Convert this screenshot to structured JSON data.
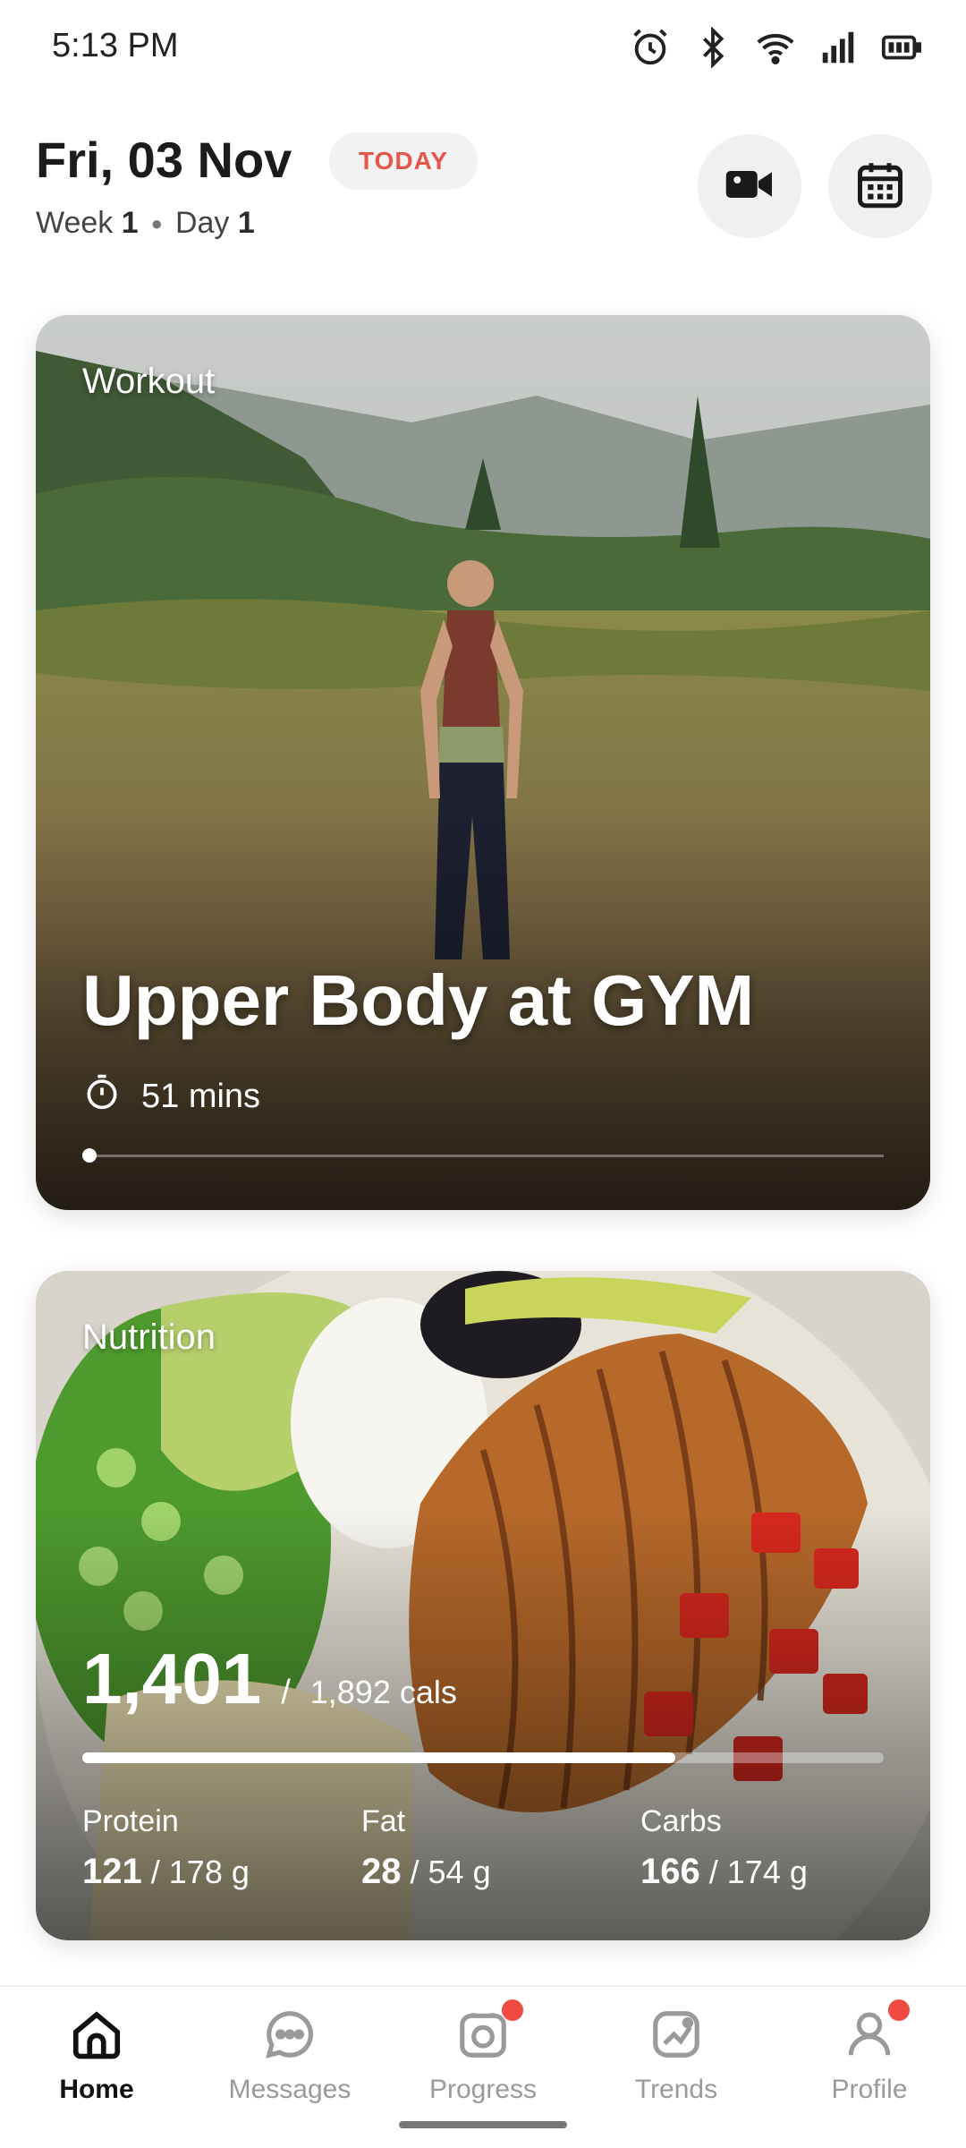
{
  "status_bar": {
    "time": "5:13 PM",
    "icons": [
      "alarm-icon",
      "bluetooth-icon",
      "wifi-icon",
      "signal-icon",
      "battery-icon"
    ]
  },
  "header": {
    "date": "Fri, 03 Nov",
    "today_badge": "TODAY",
    "week_label": "Week",
    "week_value": "1",
    "day_label": "Day",
    "day_value": "1",
    "buttons": [
      "video-camera-icon",
      "calendar-icon"
    ]
  },
  "workout": {
    "label": "Workout",
    "title": "Upper Body at GYM",
    "duration": "51 mins",
    "progress": 0
  },
  "nutrition": {
    "label": "Nutrition",
    "calories_eaten": "1,401",
    "separator": "/",
    "calories_goal": "1,892 cals",
    "progress": 0.7405,
    "macros": {
      "protein": {
        "label": "Protein",
        "value": "121",
        "goal": "/ 178 g"
      },
      "fat": {
        "label": "Fat",
        "value": "28",
        "goal": "/ 54 g"
      },
      "carbs": {
        "label": "Carbs",
        "value": "166",
        "goal": "/ 174 g"
      }
    }
  },
  "bottom_nav": {
    "items": [
      {
        "label": "Home",
        "icon": "home-icon",
        "active": true,
        "badge": false
      },
      {
        "label": "Messages",
        "icon": "chat-icon",
        "active": false,
        "badge": false
      },
      {
        "label": "Progress",
        "icon": "camera-icon",
        "active": false,
        "badge": true
      },
      {
        "label": "Trends",
        "icon": "trend-chart-icon",
        "active": false,
        "badge": false
      },
      {
        "label": "Profile",
        "icon": "user-icon",
        "active": false,
        "badge": true
      }
    ]
  },
  "colors": {
    "accent_red": "#e5564c",
    "badge_red": "#ef4b43",
    "badge_bg": "#f2f2f2"
  }
}
